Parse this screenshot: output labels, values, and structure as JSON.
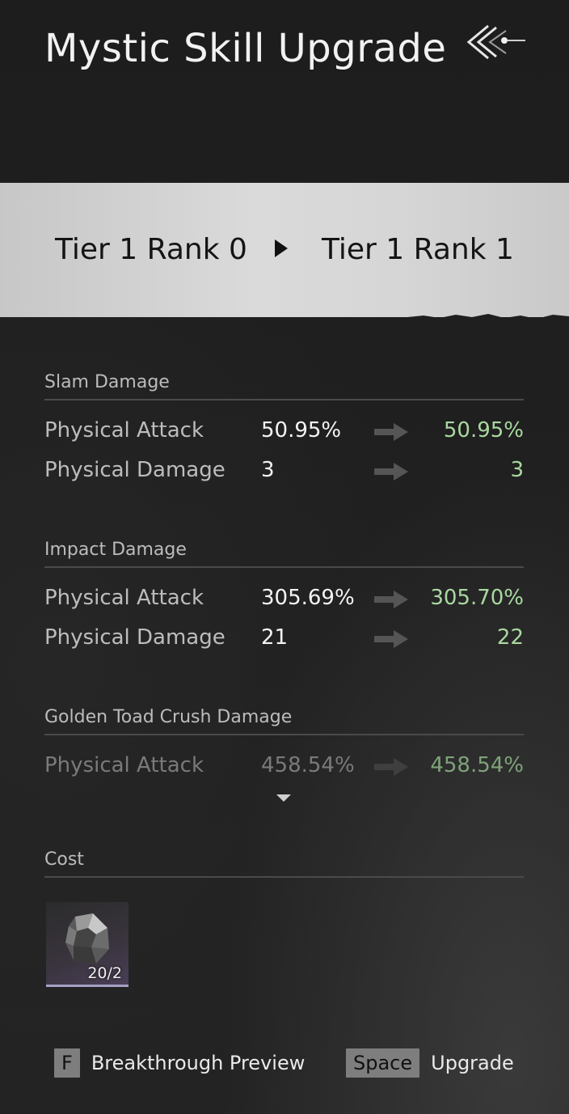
{
  "header": {
    "title": "Mystic Skill Upgrade",
    "back_icon": "back-chevron-icon"
  },
  "tier": {
    "from": "Tier 1 Rank 0",
    "to": "Tier 1 Rank 1",
    "arrow_icon": "triangle-right-icon"
  },
  "sections": [
    {
      "title": "Slam Damage",
      "rows": [
        {
          "label": "Physical Attack",
          "old": "50.95%",
          "new": "50.95%"
        },
        {
          "label": "Physical Damage",
          "old": "3",
          "new": "3"
        }
      ]
    },
    {
      "title": "Impact Damage",
      "rows": [
        {
          "label": "Physical Attack",
          "old": "305.69%",
          "new": "305.70%"
        },
        {
          "label": "Physical Damage",
          "old": "21",
          "new": "22"
        }
      ]
    },
    {
      "title": "Golden Toad Crush Damage",
      "rows": [
        {
          "label": "Physical Attack",
          "old": "458.54%",
          "new": "458.54%"
        }
      ]
    }
  ],
  "cost": {
    "title": "Cost",
    "items": [
      {
        "icon": "ore-stone-icon",
        "count": "20/2"
      }
    ]
  },
  "footer": {
    "breakthrough_key": "F",
    "breakthrough_label": "Breakthrough Preview",
    "upgrade_key": "Space",
    "upgrade_label": "Upgrade"
  },
  "colors": {
    "background": "#1f1f1f",
    "banner": "#d4d4d4",
    "increase_value": "#a9d8a0",
    "keycap": "#7e7e7e",
    "rarity_border": "#a7a0c4"
  }
}
